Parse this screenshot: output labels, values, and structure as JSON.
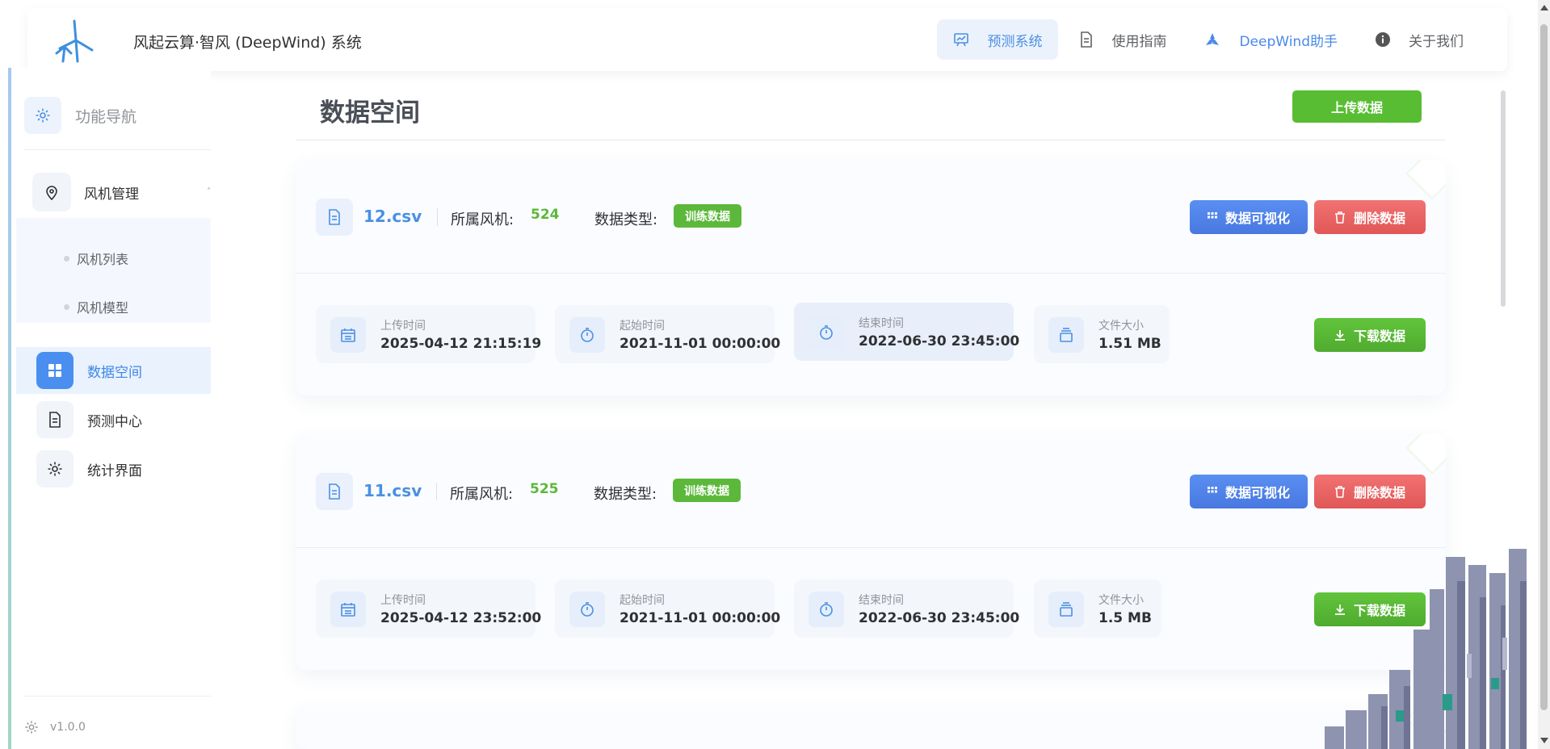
{
  "header": {
    "app_title": "风起云算·智风 (DeepWind) 系统",
    "nav": [
      {
        "label": "预测系统",
        "icon": "chart-board-icon",
        "active": true
      },
      {
        "label": "使用指南",
        "icon": "document-icon",
        "active": false
      },
      {
        "label": "DeepWind助手",
        "icon": "assistant-icon",
        "active": false
      },
      {
        "label": "关于我们",
        "icon": "info-icon",
        "active": false
      }
    ]
  },
  "sidebar": {
    "title": "功能导航",
    "group": {
      "label": "风机管理",
      "icon": "location-pin-icon",
      "expanded": true
    },
    "sub_items": [
      {
        "label": "风机列表"
      },
      {
        "label": "风机模型"
      }
    ],
    "items": [
      {
        "label": "数据空间",
        "icon": "grid-icon",
        "active": true
      },
      {
        "label": "预测中心",
        "icon": "document-icon",
        "active": false
      },
      {
        "label": "统计界面",
        "icon": "gear-icon",
        "active": false
      }
    ],
    "version": "v1.0.0"
  },
  "main": {
    "title": "数据空间",
    "upload_label": "上传数据",
    "labels": {
      "turbine": "所属风机:",
      "data_type": "数据类型:",
      "visualize": "数据可视化",
      "delete": "删除数据",
      "download": "下载数据",
      "upload_time": "上传时间",
      "start_time": "起始时间",
      "end_time": "结束时间",
      "file_size": "文件大小"
    },
    "files": [
      {
        "name": "12.csv",
        "turbine": "524",
        "type": "训练数据",
        "upload_time": "2025-04-12 21:15:19",
        "start_time": "2021-11-01 00:00:00",
        "end_time": "2022-06-30 23:45:00",
        "size": "1.51 MB"
      },
      {
        "name": "11.csv",
        "turbine": "525",
        "type": "训练数据",
        "upload_time": "2025-04-12 23:52:00",
        "start_time": "2021-11-01 00:00:00",
        "end_time": "2022-06-30 23:45:00",
        "size": "1.5 MB"
      }
    ]
  },
  "colors": {
    "accent": "#4a90e2",
    "success": "#5cb83a",
    "danger": "#e05757",
    "primary_button": "#4878e0"
  }
}
